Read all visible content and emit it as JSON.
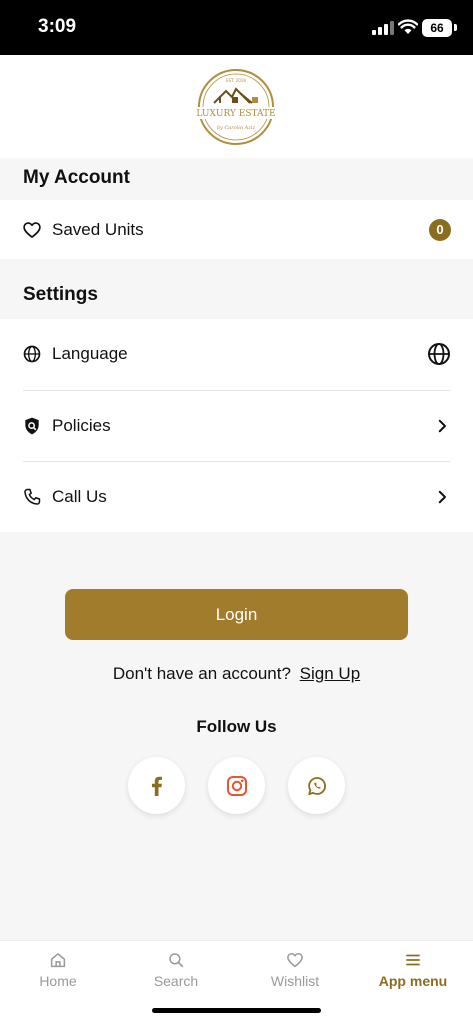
{
  "status_bar": {
    "time": "3:09",
    "battery": "66"
  },
  "logo": {
    "top_text": "EST. 2018",
    "main_text": "LUXURY ESTATE",
    "sub_text": "by Carolin Aziz"
  },
  "my_account": {
    "title": "My Account",
    "saved_units": {
      "label": "Saved Units",
      "count": "0"
    }
  },
  "settings": {
    "title": "Settings",
    "items": [
      {
        "label": "Language"
      },
      {
        "label": "Policies"
      },
      {
        "label": "Call Us"
      }
    ]
  },
  "auth": {
    "login_label": "Login",
    "no_account_text": "Don't have an account?",
    "signup_label": "Sign Up"
  },
  "follow": {
    "title": "Follow Us",
    "networks": [
      "facebook",
      "instagram",
      "whatsapp"
    ]
  },
  "tab_bar": {
    "tabs": [
      {
        "label": "Home",
        "icon": "home-icon"
      },
      {
        "label": "Search",
        "icon": "search-icon"
      },
      {
        "label": "Wishlist",
        "icon": "heart-icon"
      },
      {
        "label": "App menu",
        "icon": "menu-icon"
      }
    ],
    "active": "App menu"
  },
  "colors": {
    "accent": "#a07c2c",
    "accent_dark": "#8b6d1f",
    "instagram": "#e1306c",
    "background": "#f6f6f6"
  }
}
